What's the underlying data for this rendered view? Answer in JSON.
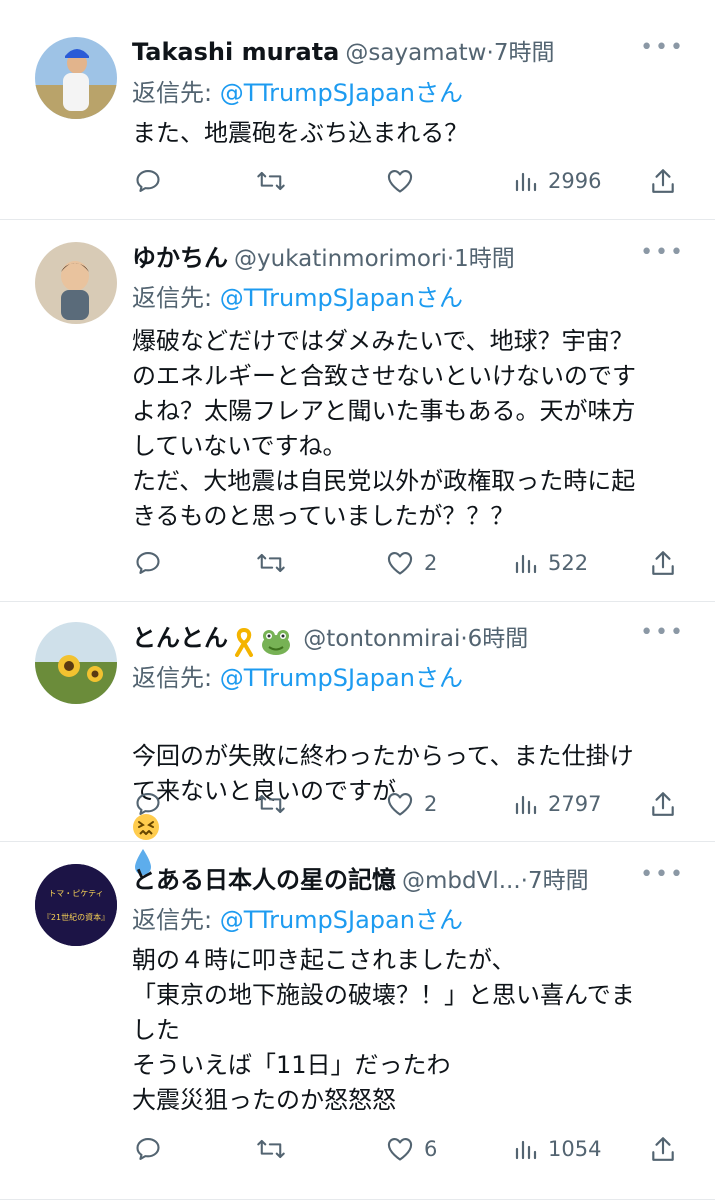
{
  "tweets": [
    {
      "name": "Takashi murata",
      "handle": "@sayamatw",
      "dot": "·",
      "time": "7時間",
      "reply_prefix": "返信先: ",
      "reply_mention": "@TTrumpSJapan",
      "reply_suffix": "さん",
      "text": "また、地震砲をぶち込まれる？",
      "likes": "",
      "views": "2996"
    },
    {
      "name": "ゆかちん",
      "handle": "@yukatinmorimori",
      "dot": "·",
      "time": "1時間",
      "reply_prefix": "返信先: ",
      "reply_mention": "@TTrumpSJapan",
      "reply_suffix": "さん",
      "text": "爆破などだけではダメみたいで、地球？宇宙？\nのエネルギーと合致させないといけないのです\nよね？太陽フレアと聞いた事もある。天が味方\nしていないですね。\nただ、大地震は自民党以外が政権取った時に起\nきるものと思っていましたが？？？",
      "likes": "2",
      "views": "522"
    },
    {
      "name": "とんとん",
      "handle": "@tontonmirai",
      "dot": "·",
      "time": "6時間",
      "reply_prefix": "返信先: ",
      "reply_mention": "@TTrumpSJapan",
      "reply_suffix": "さん",
      "text": "今回のが失敗に終わったからって、また仕掛け\nて来ないと良いのですが",
      "likes": "2",
      "views": "2797"
    },
    {
      "name": "とある日本人の星の記憶",
      "handle": "@mbdVl...",
      "dot": "·",
      "time": "7時間",
      "reply_prefix": "返信先: ",
      "reply_mention": "@TTrumpSJapan",
      "reply_suffix": "さん",
      "text": "朝の４時に叩き起こされましたが、\n「東京の地下施設の破壊？！」と思い喜んでま\nした\nそういえば「11日」だったわ\n大震災狙ったのか怒怒怒",
      "likes": "6",
      "views": "1054",
      "avatar_text_top": "トマ・ピケティ",
      "avatar_text_bottom": "『21世紀の資本』"
    }
  ],
  "colors": {
    "mention": "#1d9bf0",
    "secondary": "#536471",
    "text": "#0f1419",
    "divider": "#e6e9ec"
  },
  "icons": [
    "reply-icon",
    "retweet-icon",
    "like-icon",
    "views-icon",
    "share-icon",
    "more-icon"
  ]
}
